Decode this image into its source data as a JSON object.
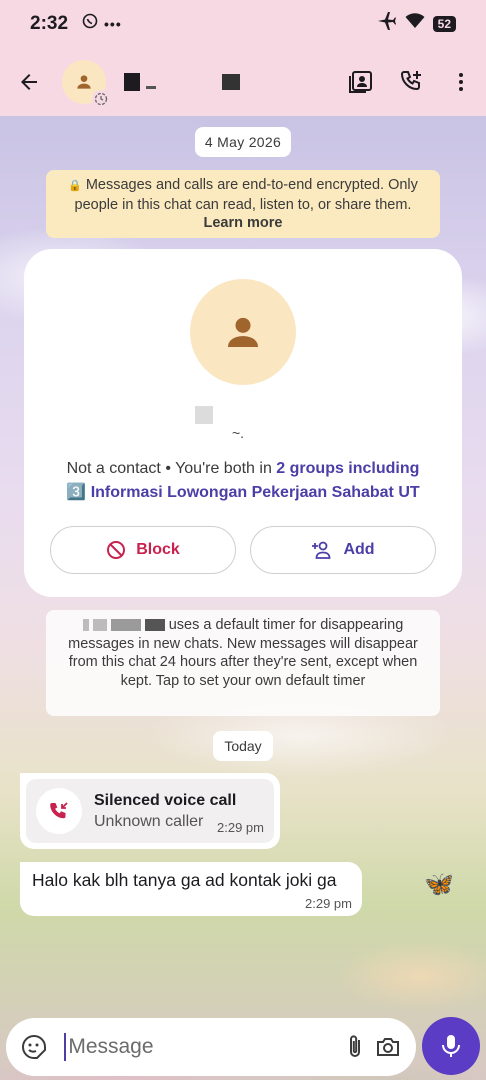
{
  "status_bar": {
    "time": "2:32",
    "battery": "52",
    "icons": [
      "whatsapp-icon",
      "more-notifications-icon",
      "airplane-icon",
      "wifi-icon",
      "battery-icon"
    ]
  },
  "app_bar": {
    "back_icon": "arrow-left-icon",
    "actions": [
      "contact-card-icon",
      "add-call-icon",
      "more-vert-icon"
    ]
  },
  "chat": {
    "date_chip": "4 May 2026",
    "encryption_text": "Messages and calls are end-to-end encrypted. Only people in this chat can read, listen to, or share them.",
    "encryption_link": "Learn more",
    "profile": {
      "name_suffix": "~.",
      "not_contact": "Not a contact",
      "groups_prefix": "You're both in",
      "groups_link": "2 groups including",
      "group_name": "3️⃣ Informasi Lowongan Pekerjaan Sahabat UT",
      "block_label": "Block",
      "add_label": "Add"
    },
    "timer_note": "uses a default timer for disappearing messages in new chats. New messages will disappear from this chat 24 hours after they're sent, except when kept. Tap to set your own default timer",
    "today_chip": "Today",
    "call": {
      "title": "Silenced voice call",
      "subtitle": "Unknown caller",
      "time": "2:29 pm"
    },
    "message": {
      "text": "Halo kak blh tanya ga ad kontak joki ga",
      "time": "2:29 pm"
    }
  },
  "composer": {
    "placeholder": "Message",
    "icons": [
      "sticker-icon",
      "attach-icon",
      "camera-icon",
      "mic-icon"
    ]
  },
  "colors": {
    "accent": "#4b3ea6",
    "block": "#c8234e",
    "header_bg": "#f6d9e3",
    "mic_bg": "#5b3cc4"
  }
}
